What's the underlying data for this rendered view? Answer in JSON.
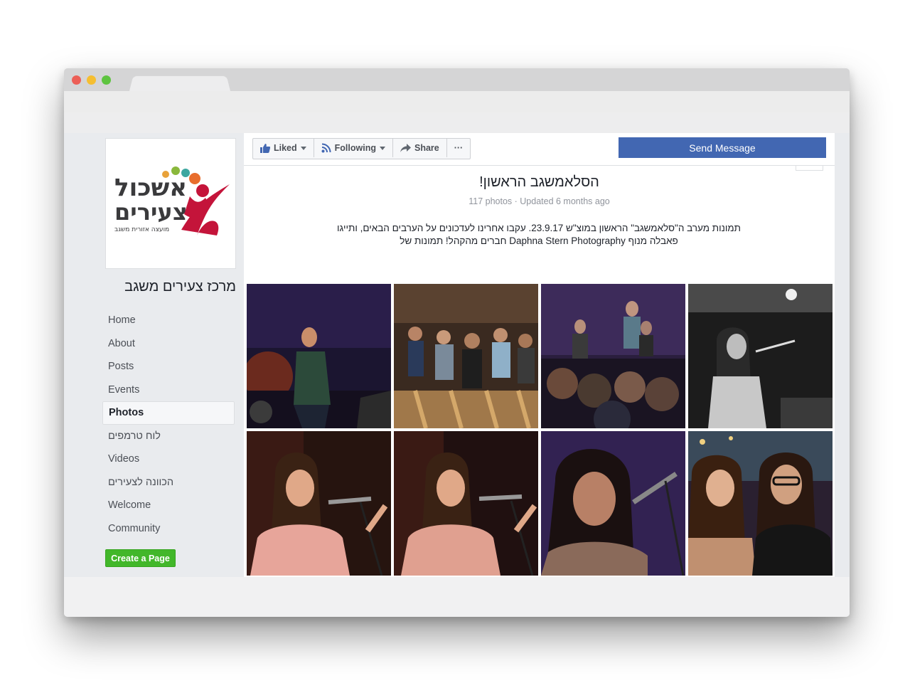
{
  "page": {
    "name": "מרכז צעירים משגב",
    "logo": {
      "line1": "אשכול",
      "line2": "צעירים",
      "sub": "מועצה אזורית משגב"
    }
  },
  "nav": {
    "items": [
      {
        "label": "Home"
      },
      {
        "label": "About"
      },
      {
        "label": "Posts"
      },
      {
        "label": "Events"
      },
      {
        "label": "Photos"
      },
      {
        "label": "לוח טרמפים"
      },
      {
        "label": "Videos"
      },
      {
        "label": "הכוונה לצעירים"
      },
      {
        "label": "Welcome"
      },
      {
        "label": "Community"
      }
    ],
    "active": "Photos"
  },
  "create_page_label": "Create a Page",
  "actions": {
    "liked": "Liked",
    "following": "Following",
    "share": "Share",
    "more": "···",
    "send_message": "Send Message"
  },
  "album": {
    "title": "הסלאמשגב הראשון!",
    "meta": "117 photos · Updated 6 months ago",
    "description_line1": "תמונות מערב ה\"סלאמשגב\" הראשון במוצ\"ש 23.9.17. עקבו אחרינו לעדכונים על הערבים הבאים, ותייגו",
    "description_line2": "פאבלה מנוף Daphna Stern Photography חברים מהקהל! תמונות של"
  },
  "photos": [
    {
      "icon": "singer-with-guitar-photo"
    },
    {
      "icon": "audience-in-bar-photo"
    },
    {
      "icon": "band-on-stage-photo"
    },
    {
      "icon": "black-white-singer-photo"
    },
    {
      "icon": "singer-pink-shirt-photo"
    },
    {
      "icon": "singer-pink-shirt-photo-2"
    },
    {
      "icon": "singer-closeup-photo"
    },
    {
      "icon": "two-women-smiling-photo"
    }
  ],
  "colors": {
    "brand_blue": "#4267b2",
    "create_green": "#42b72a",
    "logo_red": "#c4143a"
  }
}
